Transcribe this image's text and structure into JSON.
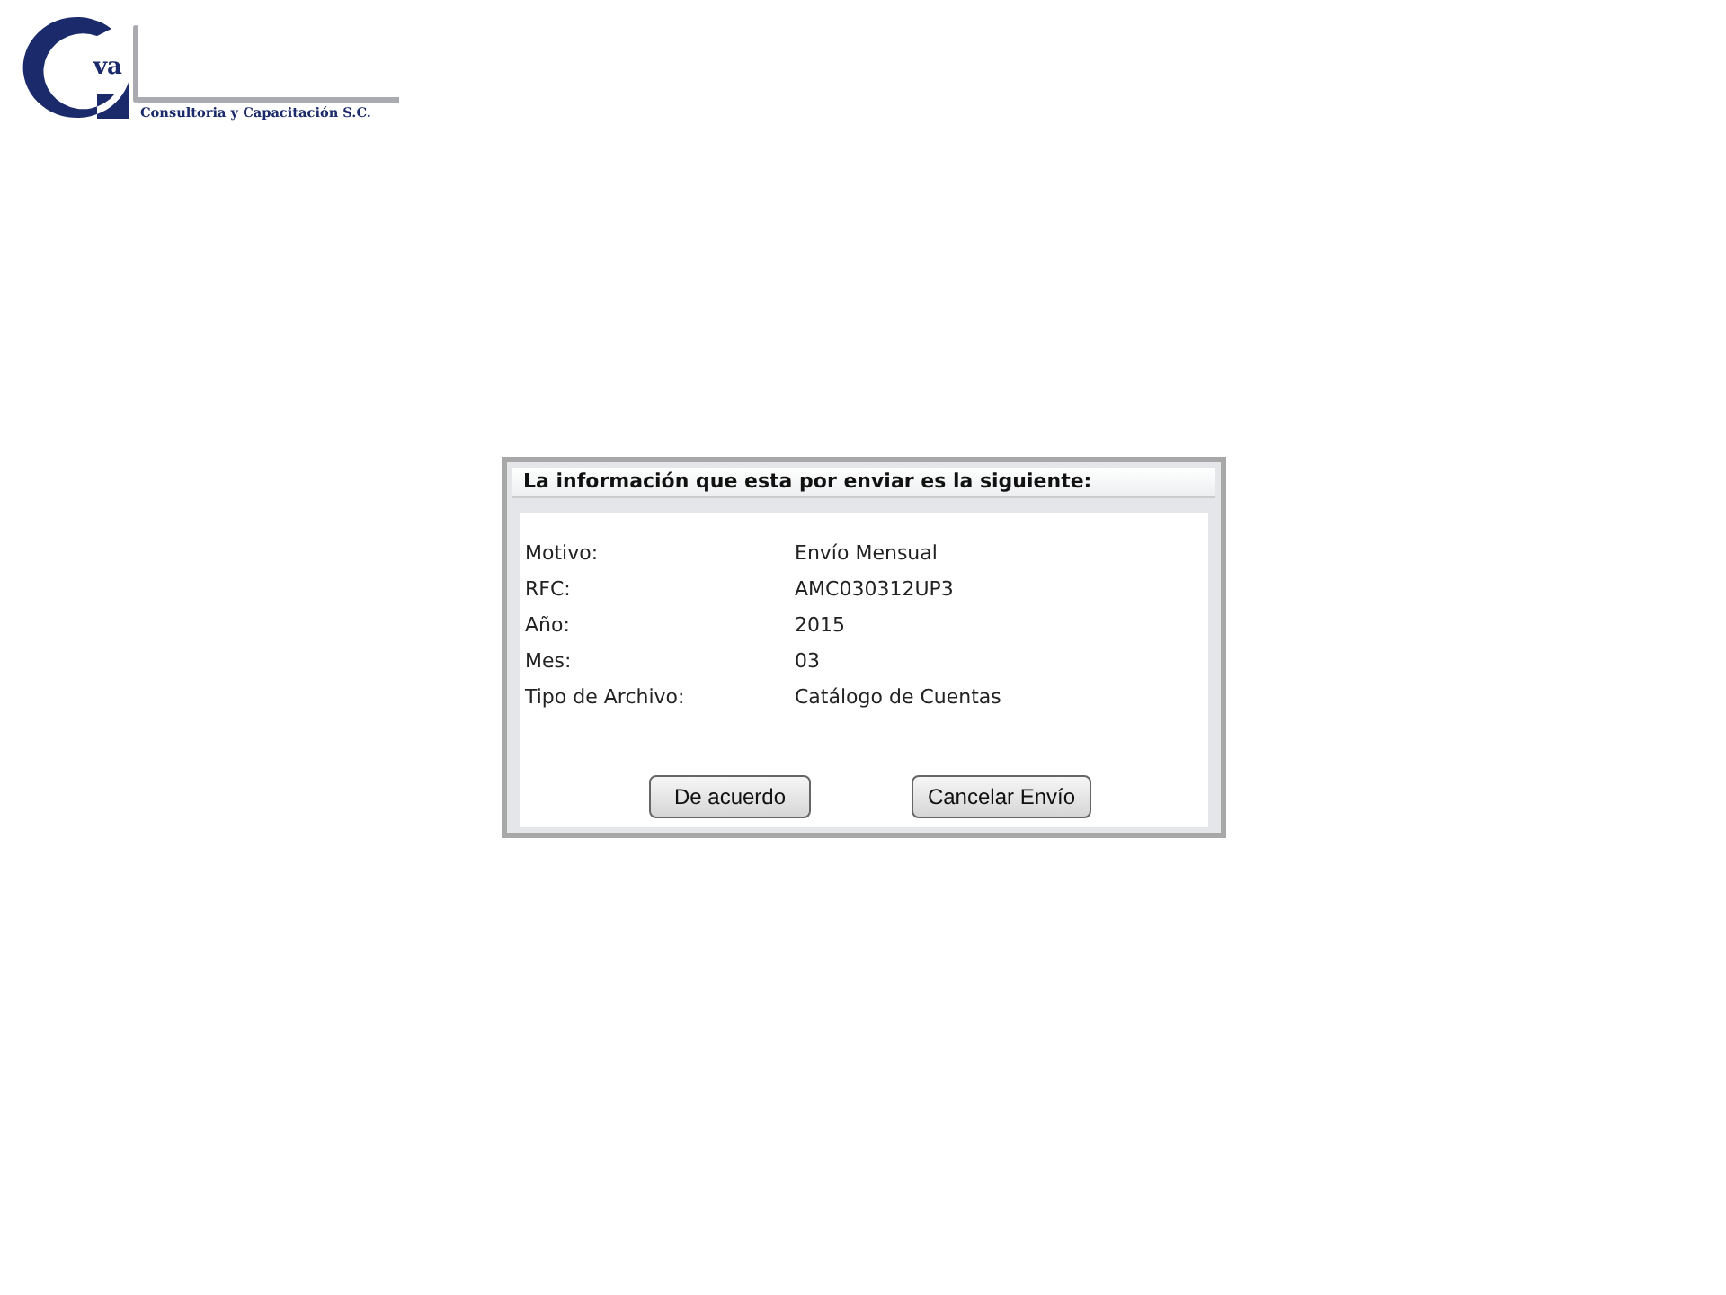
{
  "logo": {
    "small": "va",
    "tagline": "Consultoria y Capacitación S.C."
  },
  "dialog": {
    "title": "La información que esta por enviar es la siguiente:",
    "fields": [
      {
        "label": "Motivo:",
        "value": "Envío Mensual"
      },
      {
        "label": "RFC:",
        "value": "AMC030312UP3"
      },
      {
        "label": "Año:",
        "value": "2015"
      },
      {
        "label": "Mes:",
        "value": "03"
      },
      {
        "label": "Tipo de Archivo:",
        "value": "Catálogo de Cuentas"
      }
    ],
    "buttons": [
      "De acuerdo",
      "Cancelar Envío"
    ]
  }
}
